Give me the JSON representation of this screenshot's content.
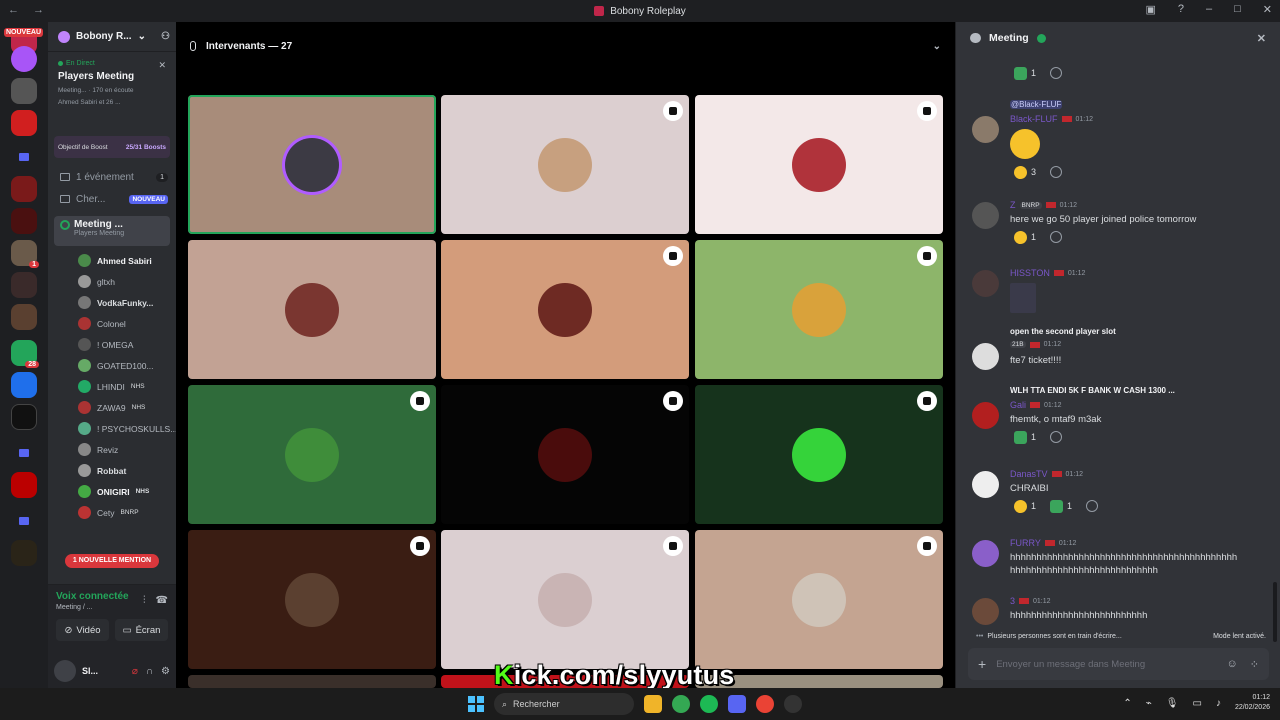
{
  "window": {
    "title": "Bobony Roleplay"
  },
  "servers": {
    "new_badge": "NOUVEAU",
    "unread_counts": [
      "1",
      "28"
    ]
  },
  "guild": {
    "name": "Bobony R...",
    "event": {
      "live_label": "En Direct",
      "title": "Players Meeting",
      "meta": "Meeting... · 170 en écoute",
      "participants": "Ahmed Sabiri et 26 ..."
    },
    "boost": {
      "label": "Objectif de Boost",
      "count": "25/31 Boosts"
    },
    "rows": [
      {
        "label": "1 événement",
        "pill": "1"
      },
      {
        "label": "Cher...",
        "new": "NOUVEAU"
      }
    ],
    "active_channel": {
      "name": "Meeting ...",
      "sub": "Players Meeting"
    },
    "voice_members": [
      {
        "name": "Ahmed Sabiri",
        "tag": "",
        "color": "#f2f3f5",
        "bold": true
      },
      {
        "name": "gltxh",
        "tag": "",
        "color": "#b5bac1",
        "bold": false
      },
      {
        "name": "VodkaFunky...",
        "tag": "",
        "color": "#dbdee1",
        "bold": true
      },
      {
        "name": "Colonel",
        "tag": "",
        "color": "#b5bac1",
        "bold": false
      },
      {
        "name": "! OMEGA",
        "tag": "",
        "color": "#b5bac1",
        "bold": false
      },
      {
        "name": "GOATED100...",
        "tag": "",
        "color": "#b5bac1",
        "bold": false
      },
      {
        "name": "LHINDI",
        "tag": "NHS",
        "color": "#b5bac1",
        "bold": false
      },
      {
        "name": "ZAWA9",
        "tag": "NHS",
        "color": "#b5bac1",
        "bold": false
      },
      {
        "name": "! PSYCHOSKULLS...",
        "tag": "",
        "color": "#b5bac1",
        "bold": false
      },
      {
        "name": "Reviz",
        "tag": "",
        "color": "#b5bac1",
        "bold": false
      },
      {
        "name": "Robbat",
        "tag": "",
        "color": "#dbdee1",
        "bold": true
      },
      {
        "name": "ONIGIRI",
        "tag": "NHS",
        "color": "#f2f3f5",
        "bold": true
      },
      {
        "name": "Cety",
        "tag": "BNRP",
        "color": "#b5bac1",
        "bold": false
      }
    ],
    "mention_banner": "1 NOUVELLE MENTION"
  },
  "voice_panel": {
    "status": "Voix connectée",
    "sub": "Meeting / ...",
    "video_label": "Vidéo",
    "screen_label": "Écran"
  },
  "user_panel": {
    "name": "Sl..."
  },
  "stage": {
    "header": "Intervenants — 27",
    "tiles": [
      {
        "bg": "#a88c7a",
        "avatar": "#3c3a44",
        "badge": false,
        "speaking": true
      },
      {
        "bg": "#dccfd0",
        "avatar": "#c7a07f",
        "badge": true,
        "speaking": false
      },
      {
        "bg": "#f3e8e8",
        "avatar": "#b0333b",
        "badge": true,
        "speaking": false
      },
      {
        "bg": "#c2a294",
        "avatar": "#7a3630",
        "badge": false,
        "speaking": false
      },
      {
        "bg": "#d39c7b",
        "avatar": "#6e2a23",
        "badge": true,
        "speaking": false
      },
      {
        "bg": "#8db56a",
        "avatar": "#d9a23b",
        "badge": true,
        "speaking": false
      },
      {
        "bg": "#2f6b3a",
        "avatar": "#3f8d3a",
        "badge": true,
        "speaking": false
      },
      {
        "bg": "#050505",
        "avatar": "#4a0c0c",
        "badge": true,
        "speaking": false
      },
      {
        "bg": "#16331c",
        "avatar": "#35d33a",
        "badge": true,
        "speaking": false
      },
      {
        "bg": "#3a1d13",
        "avatar": "#5b4030",
        "badge": true,
        "speaking": false
      },
      {
        "bg": "#dbcfd1",
        "avatar": "#c9b4b4",
        "badge": true,
        "speaking": false
      },
      {
        "bg": "#c4a491",
        "avatar": "#cfc3b7",
        "badge": true,
        "speaking": false
      }
    ],
    "watermark_k": "K",
    "watermark_rest": "ick.com/slyyutus"
  },
  "chat": {
    "title": "Meeting",
    "messages": [
      {
        "reply": "@Black-FLUF",
        "name": "Black-FLUF",
        "time": "01:12",
        "text": "",
        "emoji": true,
        "reacts": [
          {
            "type": "laugh",
            "count": "3"
          }
        ],
        "avatar": "#8a7a6a"
      },
      {
        "reply": "",
        "name": "Z",
        "tag": "BNRP",
        "time": "01:12",
        "text": "here we go 50 player joined police tomorrow",
        "reacts": [
          {
            "type": "laugh",
            "count": "1"
          }
        ],
        "avatar": "#555"
      },
      {
        "reply": "",
        "name": "HISSTON",
        "time": "01:12",
        "text": "",
        "image": true,
        "reacts": [],
        "avatar": "#4a3a3a"
      },
      {
        "reply": "open the second player slot",
        "reply_tag": "21B",
        "name": "",
        "tag": "21B",
        "time": "01:12",
        "text": "fte7 ticket!!!!",
        "reacts": [],
        "avatar": "#ddd"
      },
      {
        "reply": "WLH TTA ENDI 5K F BANK W CASH 1300 ...",
        "name": "Gali",
        "time": "01:12",
        "text": "fhemtk, o mtaf9 m3ak",
        "reacts": [
          {
            "type": "check",
            "count": "1"
          }
        ],
        "avatar": "#b21f1f"
      },
      {
        "reply": "",
        "name": "DanasTV",
        "time": "01:12",
        "text": "CHRAIBI",
        "reacts": [
          {
            "type": "laugh",
            "count": "1"
          },
          {
            "type": "check",
            "count": "1"
          }
        ],
        "avatar": "#eee"
      },
      {
        "reply": "",
        "name": "FURRY",
        "time": "01:12",
        "text": "hhhhhhhhhhhhhhhhhhhhhhhhhhhhhhhhhhhhhhhhhhh hhhhhhhhhhhhhhhhhhhhhhhhhhhh",
        "reacts": [],
        "avatar": "#8a5fc9"
      },
      {
        "reply": "",
        "name": "3",
        "time": "01:12",
        "text": "hhhhhhhhhhhhhhhhhhhhhhhhhh",
        "reacts": [],
        "avatar": "#6b4a3a"
      }
    ],
    "top_react_count": "1",
    "typing": "Plusieurs personnes sont en train d'écrire...",
    "slow_mode": "Mode lent activé.",
    "composer_placeholder": "Envoyer un message dans Meeting"
  },
  "taskbar": {
    "search_placeholder": "Rechercher",
    "time": "01:12",
    "date": "22/02/2026"
  }
}
